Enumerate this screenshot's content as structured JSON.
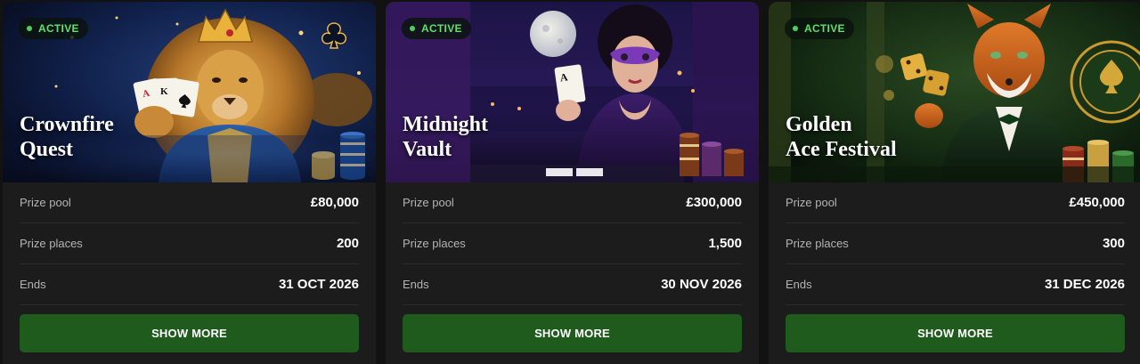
{
  "cards": [
    {
      "badge": "ACTIVE",
      "title_line1": "Crownfire",
      "title_line2": "Quest",
      "prize_pool_label": "Prize pool",
      "prize_pool_value": "£80,000",
      "prize_places_label": "Prize places",
      "prize_places_value": "200",
      "ends_label": "Ends",
      "ends_value": "31 OCT 2026",
      "button_label": "SHOW MORE"
    },
    {
      "badge": "ACTIVE",
      "title_line1": "Midnight",
      "title_line2": "Vault",
      "prize_pool_label": "Prize pool",
      "prize_pool_value": "£300,000",
      "prize_places_label": "Prize places",
      "prize_places_value": "1,500",
      "ends_label": "Ends",
      "ends_value": "30 NOV 2026",
      "button_label": "SHOW MORE"
    },
    {
      "badge": "ACTIVE",
      "title_line1": "Golden",
      "title_line2": "Ace Festival",
      "prize_pool_label": "Prize pool",
      "prize_pool_value": "£450,000",
      "prize_places_label": "Prize places",
      "prize_places_value": "300",
      "ends_label": "Ends",
      "ends_value": "31 DEC 2026",
      "button_label": "SHOW MORE"
    }
  ],
  "colors": {
    "page_bg": "#121212",
    "card_bg": "#1c1c1c",
    "button_bg": "#1f5b1d",
    "badge_text": "#5de06a"
  }
}
